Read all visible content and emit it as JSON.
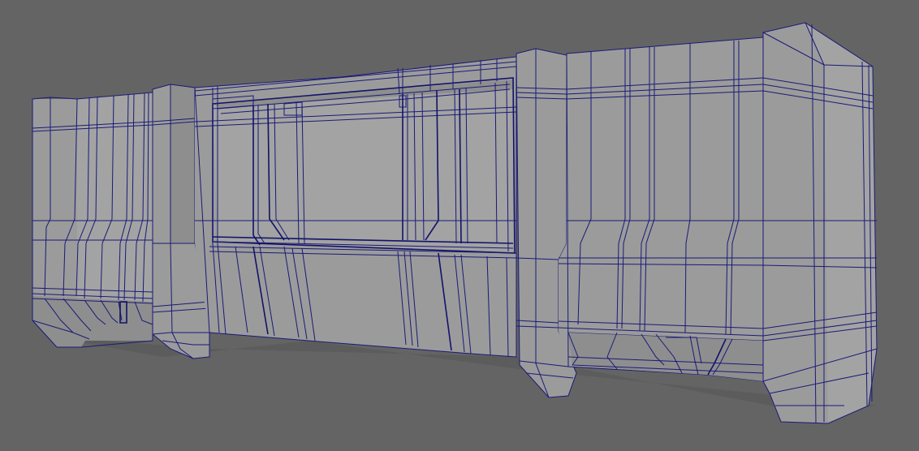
{
  "viewport": {
    "background_color": "#646464",
    "mesh_fill_color": "#9b9b9b",
    "wireframe_color": "#1a1a78",
    "display_mode": "wireframe-on-shaded"
  }
}
